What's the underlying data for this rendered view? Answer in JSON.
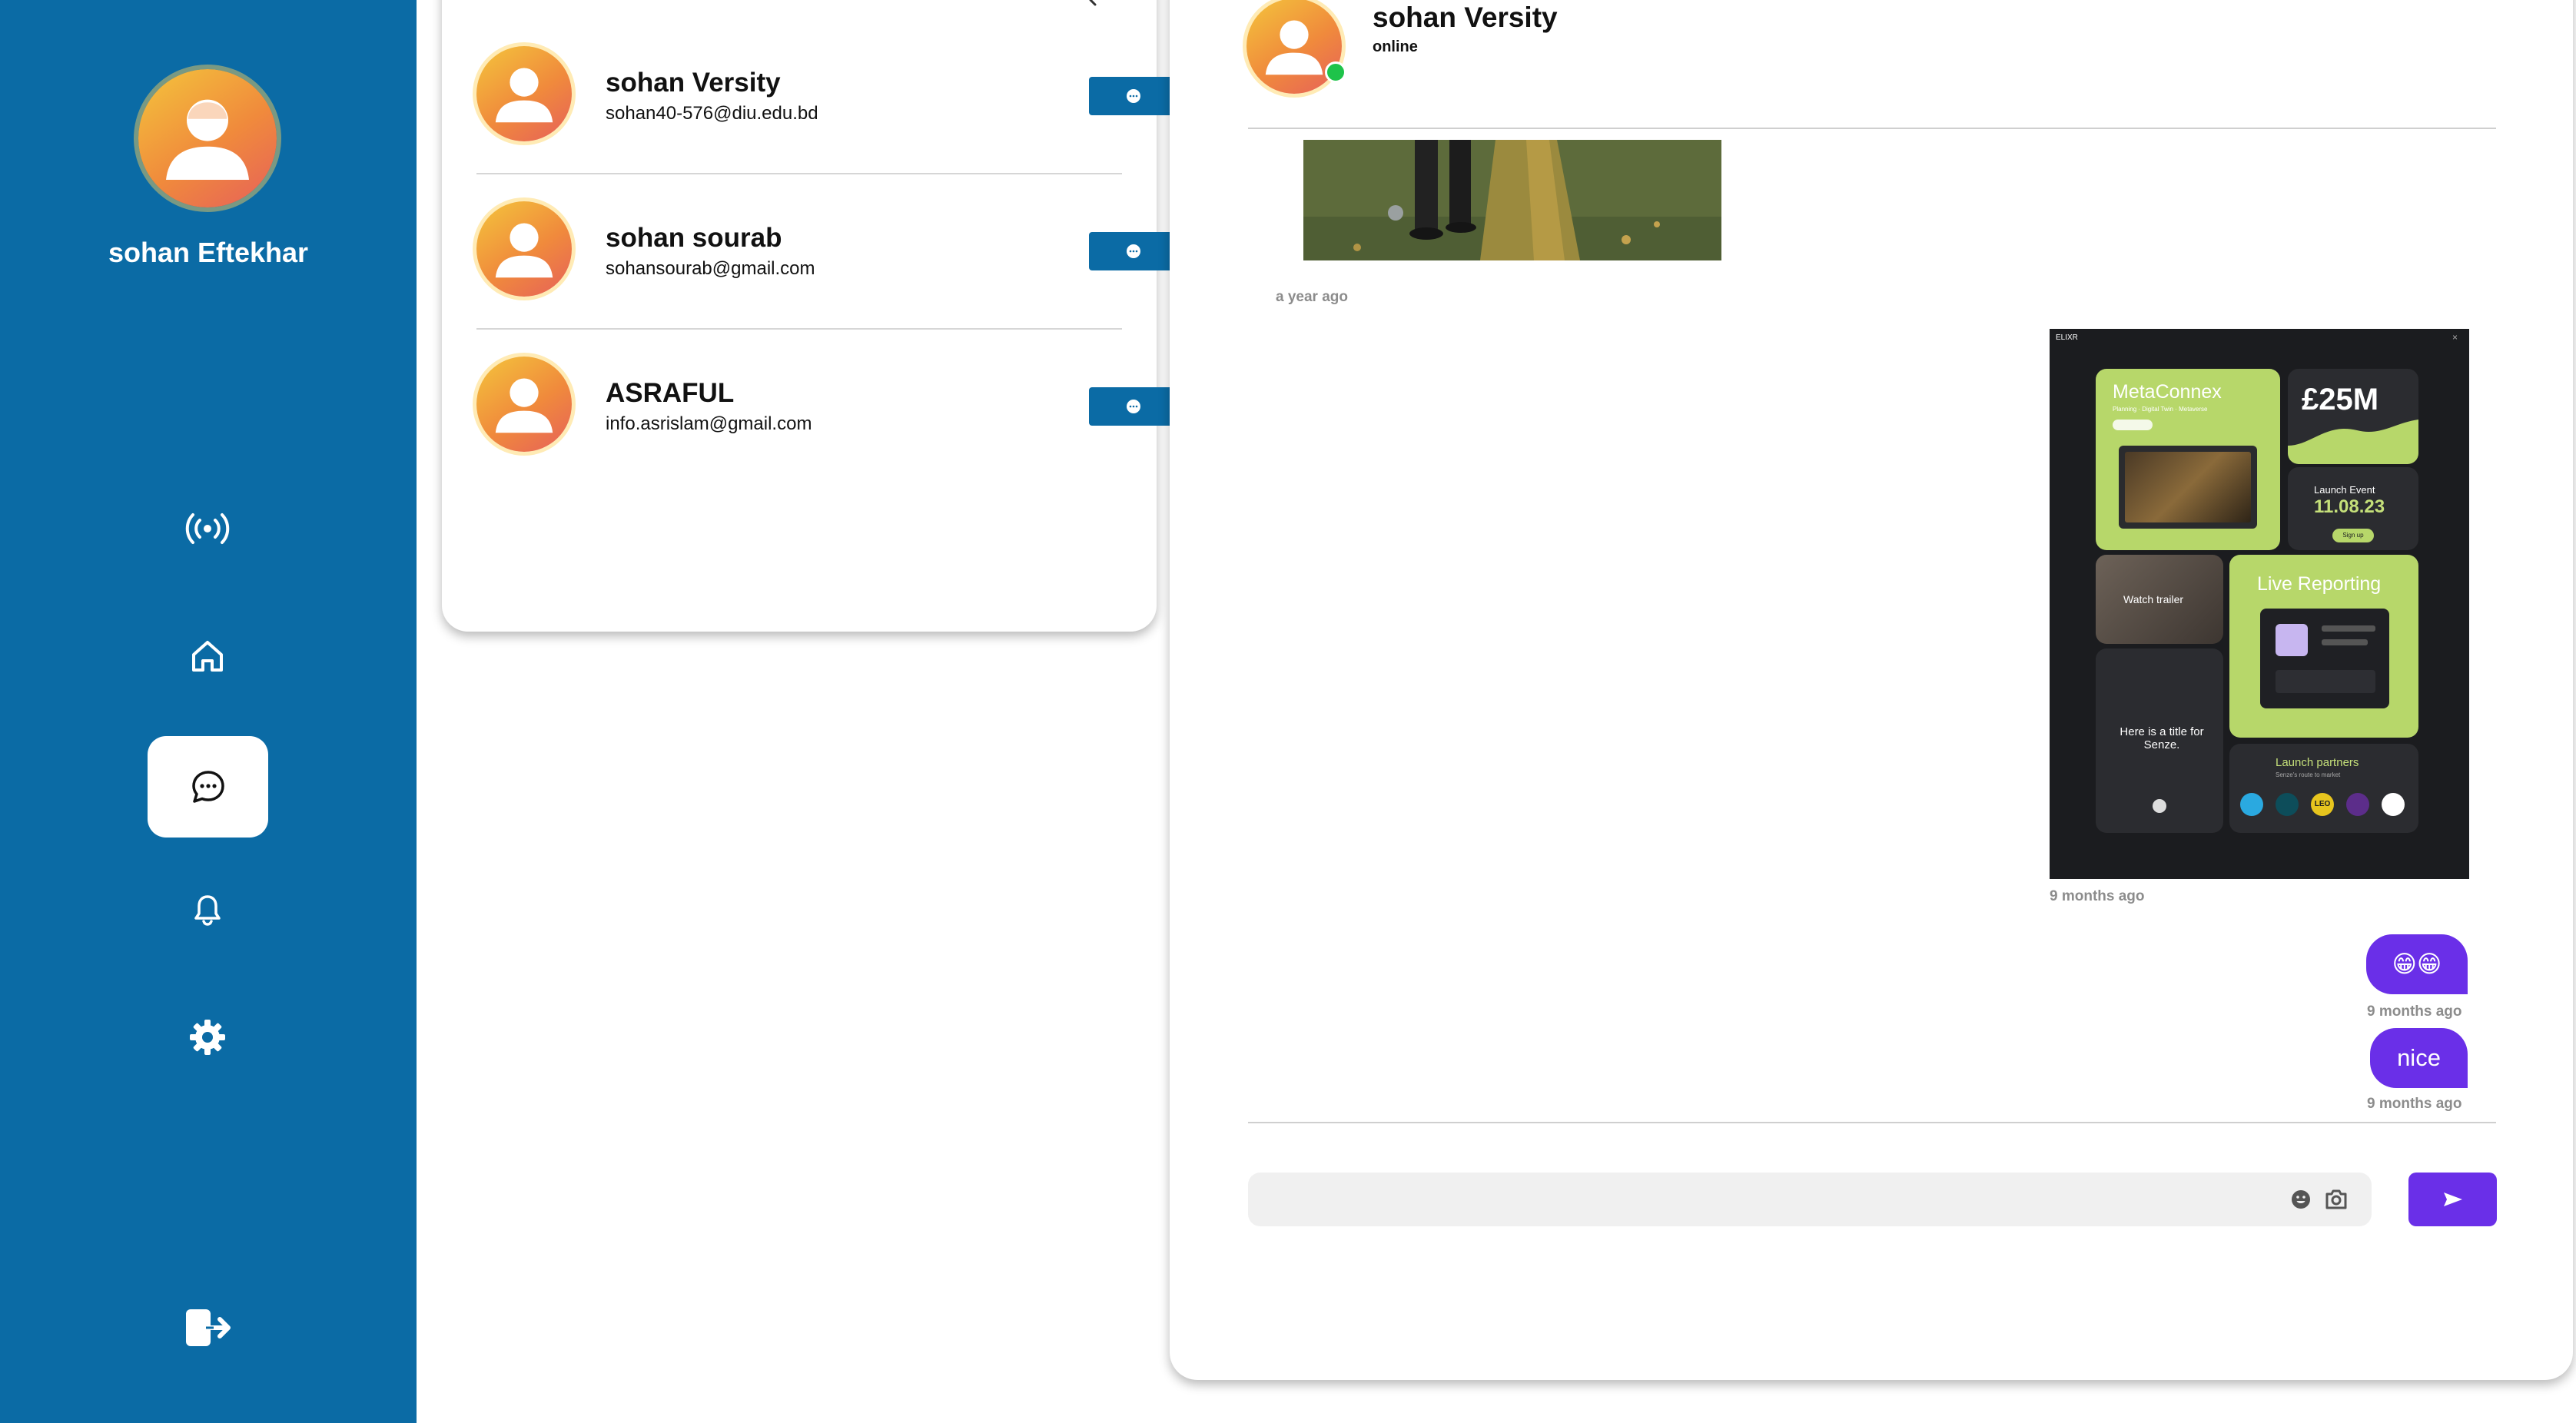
{
  "sidebar": {
    "user_name": "sohan Eftekhar",
    "nav_items": [
      {
        "icon": "broadcast-icon"
      },
      {
        "icon": "home-icon"
      },
      {
        "icon": "chat-icon",
        "active": true
      },
      {
        "icon": "bell-icon"
      },
      {
        "icon": "gear-icon"
      }
    ],
    "logout_icon": "logout-icon",
    "colors": {
      "background": "#0b6ba5",
      "active_bg": "#ffffff"
    }
  },
  "contacts": [
    {
      "name": "sohan Versity",
      "email": "sohan40-576@diu.edu.bd"
    },
    {
      "name": "sohan sourab",
      "email": "sohansourab@gmail.com"
    },
    {
      "name": "ASRAFUL",
      "email": "info.asrislam@gmail.com"
    }
  ],
  "chat": {
    "partner_name": "sohan Versity",
    "partner_status": "online",
    "messages": [
      {
        "direction": "received",
        "type": "image",
        "timestamp": "a year ago"
      },
      {
        "direction": "sent",
        "type": "image",
        "timestamp": "9 months ago",
        "image_text": {
          "brand": "ELIXR",
          "card1_title": "MetaConnex",
          "card1_sub": "Planning · Digital Twin · Metaverse",
          "card2_value": "£25M",
          "card3_label": "Launch Event",
          "card3_date": "11.08.23",
          "card3_button": "Sign up",
          "card4_label": "Watch trailer",
          "card5_title": "Live Reporting",
          "card6_text": "Here is a title for Senze.",
          "card7_title": "Launch partners",
          "card7_sub": "Senze's route to market",
          "partner_logo_text": "LEO"
        }
      },
      {
        "direction": "sent",
        "type": "text",
        "text": "😁😁",
        "timestamp": "9 months ago"
      },
      {
        "direction": "sent",
        "type": "text",
        "text": "nice",
        "timestamp": "9 months ago"
      }
    ],
    "composer": {
      "value": "",
      "placeholder": ""
    },
    "colors": {
      "bubble": "#6a2fe8",
      "online": "#1ec34a"
    }
  }
}
